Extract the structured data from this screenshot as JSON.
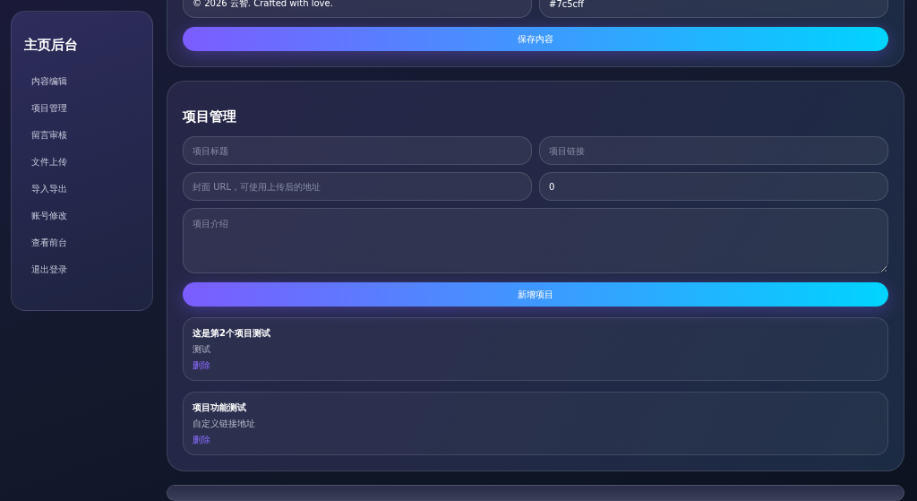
{
  "sidebar": {
    "title": "主页后台",
    "items": [
      "内容编辑",
      "项目管理",
      "留言审核",
      "文件上传",
      "导入导出",
      "账号修改",
      "查看前台",
      "退出登录"
    ]
  },
  "content_form": {
    "fields": [
      {
        "value": "© 2026 云智. Crafted with love."
      },
      {
        "value": "#7c5cff"
      }
    ],
    "button": "保存内容"
  },
  "project_section": {
    "title": "项目管理",
    "fields": [
      {
        "placeholder": "项目标题"
      },
      {
        "placeholder": "项目链接"
      },
      {
        "placeholder": "封面 URL，可使用上传后的地址"
      },
      {
        "value": "0"
      }
    ],
    "textarea": {
      "placeholder": "项目介绍"
    },
    "button": "新增项目",
    "projects": [
      {
        "title": "这是第2个项目测试",
        "description": "测试",
        "action": "删除"
      },
      {
        "title": "项目功能测试",
        "description": "自定义链接地址",
        "action": "删除"
      }
    ]
  }
}
